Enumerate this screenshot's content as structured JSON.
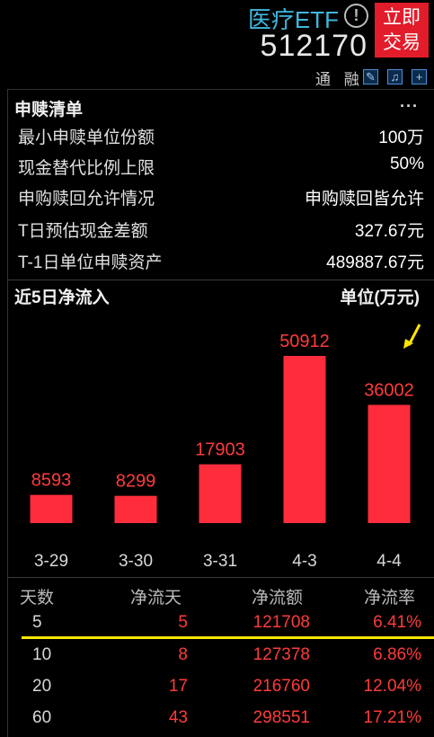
{
  "header": {
    "fund_name": "医疗ETF",
    "fund_code": "512170",
    "trade_button": "立即\n交易",
    "trade_line1": "立即",
    "trade_line2": "交易",
    "tags": "通 融",
    "alert_icon": "exclamation-icon"
  },
  "redemption": {
    "title": "申赎清单",
    "more": "···",
    "rows": [
      {
        "label": "最小申赎单位份额",
        "value": "100万"
      },
      {
        "label": "现金替代比例上限",
        "value": "50%"
      },
      {
        "label": "申购赎回允许情况",
        "value": "申购赎回皆允许"
      },
      {
        "label": "T日预估现金差额",
        "value": "327.67元"
      },
      {
        "label": "T-1日单位申赎资产",
        "value": "489887.67元"
      }
    ]
  },
  "inflow": {
    "title": "近5日净流入",
    "unit": "单位(万元)"
  },
  "chart_data": {
    "type": "bar",
    "title": "近5日净流入",
    "ylabel": "单位(万元)",
    "categories": [
      "3-29",
      "3-30",
      "3-31",
      "4-3",
      "4-4"
    ],
    "values": [
      8593,
      8299,
      17903,
      50912,
      36002
    ],
    "value_labels": [
      "8593",
      "8299",
      "17903",
      "50912",
      "36002"
    ],
    "bar_color": "#ff2d3b",
    "label_color": "#ff3b3b",
    "tick_color": "#d8d8d8",
    "ylim": [
      0,
      60000
    ]
  },
  "table": {
    "headers": [
      "天数",
      "净流天",
      "净流额",
      "净流率"
    ],
    "rows": [
      [
        "5",
        "5",
        "121708",
        "6.41%"
      ],
      [
        "10",
        "8",
        "127378",
        "6.86%"
      ],
      [
        "20",
        "17",
        "216760",
        "12.04%"
      ],
      [
        "60",
        "43",
        "298551",
        "17.21%"
      ]
    ]
  },
  "colors": {
    "accent_blue": "#3fb8e0",
    "trade_red": "#e21c2a",
    "value_red": "#ff3b3b",
    "highlight_yellow": "#ffe600"
  }
}
